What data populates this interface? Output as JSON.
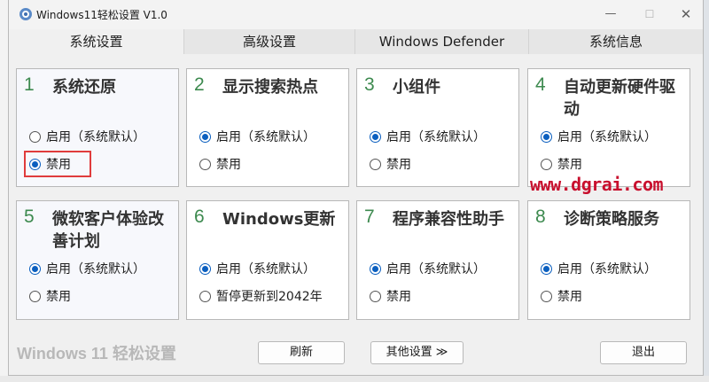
{
  "window": {
    "title": "Windows11轻松设置 V1.0"
  },
  "titlebar_controls": {
    "minimize": "—",
    "maximize": "☐",
    "close": "✕"
  },
  "tabs": [
    "系统设置",
    "高级设置",
    "Windows Defender",
    "系统信息"
  ],
  "active_tab": "系统设置",
  "cards": [
    {
      "num": "1",
      "title": "系统还原",
      "options": [
        "启用（系统默认）",
        "禁用"
      ],
      "selected": 1
    },
    {
      "num": "2",
      "title": "显示搜索热点",
      "options": [
        "启用（系统默认）",
        "禁用"
      ],
      "selected": 0
    },
    {
      "num": "3",
      "title": "小组件",
      "options": [
        "启用（系统默认）",
        "禁用"
      ],
      "selected": 0
    },
    {
      "num": "4",
      "title": "自动更新硬件驱动",
      "options": [
        "启用（系统默认）",
        "禁用"
      ],
      "selected": 0
    },
    {
      "num": "5",
      "title": "微软客户体验改善计划",
      "options": [
        "启用（系统默认）",
        "禁用"
      ],
      "selected": 0
    },
    {
      "num": "6",
      "title": "Windows更新",
      "options": [
        "启用（系统默认）",
        "暂停更新到2042年"
      ],
      "selected": 0
    },
    {
      "num": "7",
      "title": "程序兼容性助手",
      "options": [
        "启用（系统默认）",
        "禁用"
      ],
      "selected": 0
    },
    {
      "num": "8",
      "title": "诊断策略服务",
      "options": [
        "启用（系统默认）",
        "禁用"
      ],
      "selected": 0
    }
  ],
  "footer": {
    "brand": "Windows 11 轻松设置",
    "refresh": "刷新",
    "other_settings": "其他设置 ≫",
    "exit": "退出"
  },
  "watermark": "www.dgrai.com",
  "colors": {
    "accent": "#0b5fbf",
    "number": "#3d8a4f",
    "highlight": "#e03c3c",
    "watermark": "#c8102e"
  }
}
